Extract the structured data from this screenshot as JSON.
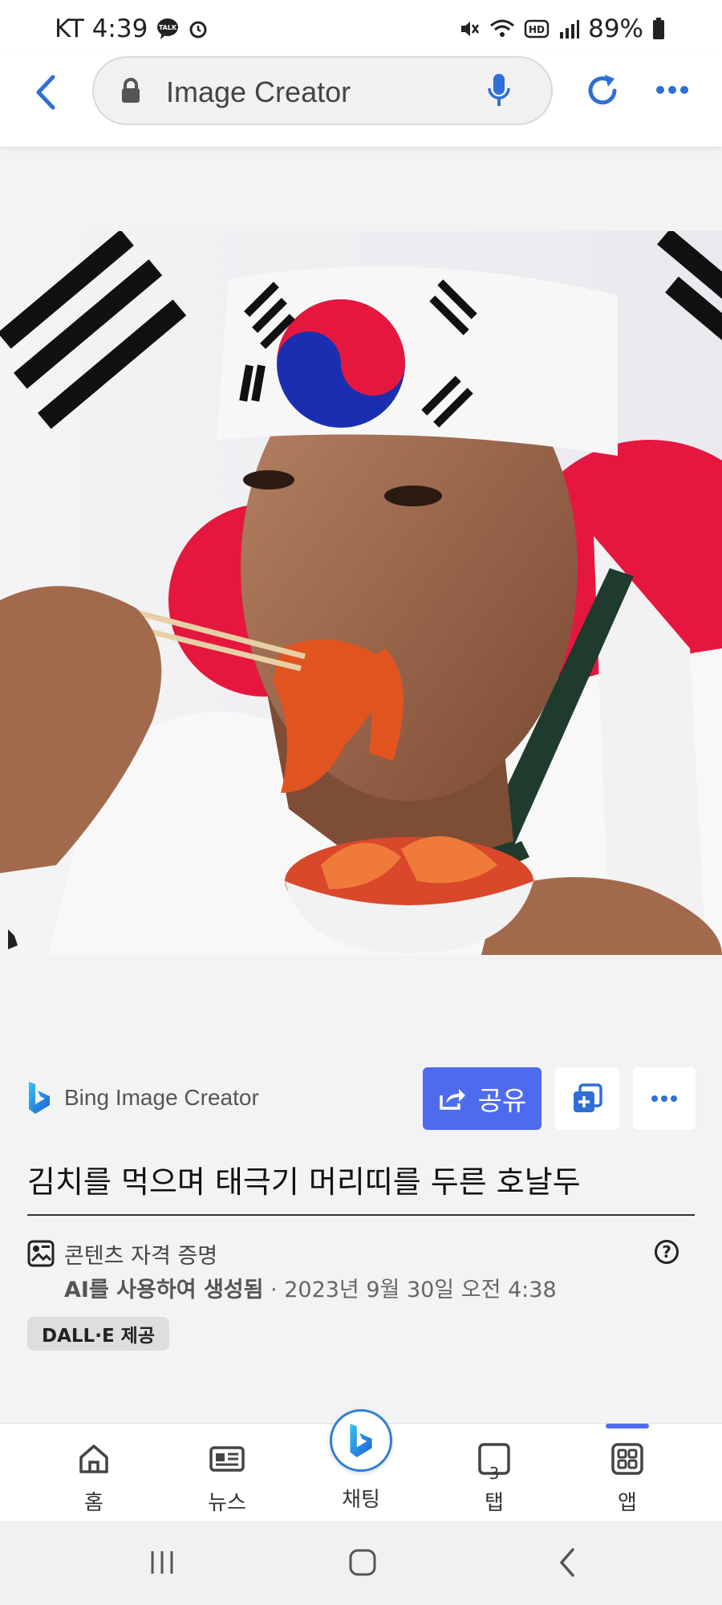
{
  "status_bar": {
    "carrier_time": "KT 4:39",
    "battery": "89%"
  },
  "address_bar": {
    "url_text": "Image Creator"
  },
  "creator": {
    "name": "Bing Image Creator",
    "share_label": "공유"
  },
  "image": {
    "title": "김치를 먹으며 태극기 머리띠를 두른 호날두"
  },
  "credentials": {
    "label": "콘텐츠 자격 증명",
    "generated": "AI를 사용하여 생성됨",
    "timestamp": " · 2023년 9월 30일 오전 4:38",
    "badge": "DALL·E 제공"
  },
  "bottom_nav": {
    "items": [
      {
        "label": "홈",
        "icon": "home-icon"
      },
      {
        "label": "뉴스",
        "icon": "news-icon"
      },
      {
        "label": "채팅",
        "icon": "bing-chat-icon"
      },
      {
        "label": "탭",
        "icon": "tabs-icon",
        "count": "3"
      },
      {
        "label": "앱",
        "icon": "apps-icon"
      }
    ],
    "active": "앱"
  },
  "colors": {
    "accent": "#4f6bed",
    "bing_blue": "#2f7ed8"
  }
}
